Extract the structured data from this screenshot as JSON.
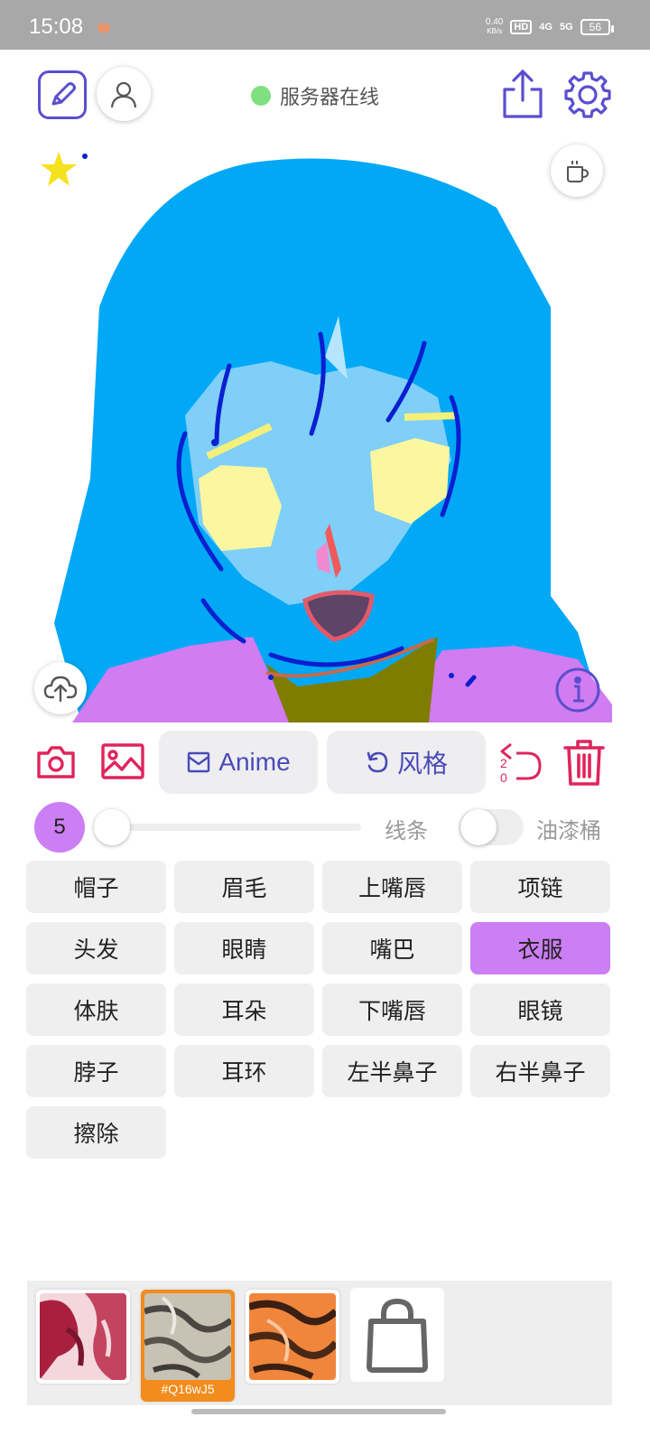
{
  "status_bar": {
    "time": "15:08",
    "speed_value": "0.40",
    "speed_unit": "KB/s",
    "hd": "HD",
    "network1": "4G",
    "network2": "5G",
    "battery": "56"
  },
  "header": {
    "server_status": "服务器在线",
    "server_status_color": "#7ee07e"
  },
  "toolbar": {
    "anime_label": "Anime",
    "style_label": "风格",
    "undo_counts": [
      "2",
      "0"
    ]
  },
  "brush": {
    "size": "5",
    "size_fraction": 0.0,
    "lines_label": "线条",
    "bucket_label": "油漆桶",
    "bucket_enabled": false
  },
  "parts": [
    {
      "label": "帽子",
      "selected": false
    },
    {
      "label": "眉毛",
      "selected": false
    },
    {
      "label": "上嘴唇",
      "selected": false
    },
    {
      "label": "项链",
      "selected": false
    },
    {
      "label": "头发",
      "selected": false
    },
    {
      "label": "眼睛",
      "selected": false
    },
    {
      "label": "嘴巴",
      "selected": false
    },
    {
      "label": "衣服",
      "selected": true
    },
    {
      "label": "体肤",
      "selected": false
    },
    {
      "label": "耳朵",
      "selected": false
    },
    {
      "label": "下嘴唇",
      "selected": false
    },
    {
      "label": "眼镜",
      "selected": false
    },
    {
      "label": "脖子",
      "selected": false
    },
    {
      "label": "耳环",
      "selected": false
    },
    {
      "label": "左半鼻子",
      "selected": false
    },
    {
      "label": "右半鼻子",
      "selected": false
    },
    {
      "label": "擦除",
      "selected": false
    }
  ],
  "textures": {
    "selected_code": "#Q16wJ5"
  },
  "colors": {
    "accent_purple": "#5a4fcf",
    "selected_part": "#cc7ef5",
    "danger_red": "#e0245e",
    "hair_blue": "#00a8f5",
    "skin_blue": "#7fcff8",
    "clothes_purple": "#d17cf0"
  }
}
